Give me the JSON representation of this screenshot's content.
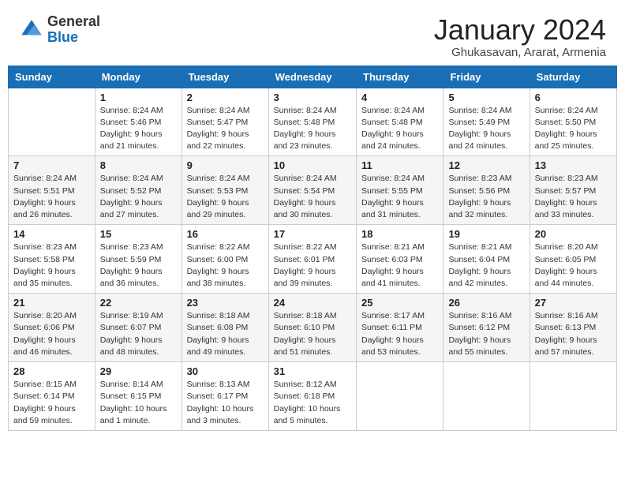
{
  "header": {
    "logo_general": "General",
    "logo_blue": "Blue",
    "month_title": "January 2024",
    "location": "Ghukasavan, Ararat, Armenia"
  },
  "weekdays": [
    "Sunday",
    "Monday",
    "Tuesday",
    "Wednesday",
    "Thursday",
    "Friday",
    "Saturday"
  ],
  "weeks": [
    [
      {
        "day": "",
        "sunrise": "",
        "sunset": "",
        "daylight": ""
      },
      {
        "day": "1",
        "sunrise": "Sunrise: 8:24 AM",
        "sunset": "Sunset: 5:46 PM",
        "daylight": "Daylight: 9 hours and 21 minutes."
      },
      {
        "day": "2",
        "sunrise": "Sunrise: 8:24 AM",
        "sunset": "Sunset: 5:47 PM",
        "daylight": "Daylight: 9 hours and 22 minutes."
      },
      {
        "day": "3",
        "sunrise": "Sunrise: 8:24 AM",
        "sunset": "Sunset: 5:48 PM",
        "daylight": "Daylight: 9 hours and 23 minutes."
      },
      {
        "day": "4",
        "sunrise": "Sunrise: 8:24 AM",
        "sunset": "Sunset: 5:48 PM",
        "daylight": "Daylight: 9 hours and 24 minutes."
      },
      {
        "day": "5",
        "sunrise": "Sunrise: 8:24 AM",
        "sunset": "Sunset: 5:49 PM",
        "daylight": "Daylight: 9 hours and 24 minutes."
      },
      {
        "day": "6",
        "sunrise": "Sunrise: 8:24 AM",
        "sunset": "Sunset: 5:50 PM",
        "daylight": "Daylight: 9 hours and 25 minutes."
      }
    ],
    [
      {
        "day": "7",
        "sunrise": "Sunrise: 8:24 AM",
        "sunset": "Sunset: 5:51 PM",
        "daylight": "Daylight: 9 hours and 26 minutes."
      },
      {
        "day": "8",
        "sunrise": "Sunrise: 8:24 AM",
        "sunset": "Sunset: 5:52 PM",
        "daylight": "Daylight: 9 hours and 27 minutes."
      },
      {
        "day": "9",
        "sunrise": "Sunrise: 8:24 AM",
        "sunset": "Sunset: 5:53 PM",
        "daylight": "Daylight: 9 hours and 29 minutes."
      },
      {
        "day": "10",
        "sunrise": "Sunrise: 8:24 AM",
        "sunset": "Sunset: 5:54 PM",
        "daylight": "Daylight: 9 hours and 30 minutes."
      },
      {
        "day": "11",
        "sunrise": "Sunrise: 8:24 AM",
        "sunset": "Sunset: 5:55 PM",
        "daylight": "Daylight: 9 hours and 31 minutes."
      },
      {
        "day": "12",
        "sunrise": "Sunrise: 8:23 AM",
        "sunset": "Sunset: 5:56 PM",
        "daylight": "Daylight: 9 hours and 32 minutes."
      },
      {
        "day": "13",
        "sunrise": "Sunrise: 8:23 AM",
        "sunset": "Sunset: 5:57 PM",
        "daylight": "Daylight: 9 hours and 33 minutes."
      }
    ],
    [
      {
        "day": "14",
        "sunrise": "Sunrise: 8:23 AM",
        "sunset": "Sunset: 5:58 PM",
        "daylight": "Daylight: 9 hours and 35 minutes."
      },
      {
        "day": "15",
        "sunrise": "Sunrise: 8:23 AM",
        "sunset": "Sunset: 5:59 PM",
        "daylight": "Daylight: 9 hours and 36 minutes."
      },
      {
        "day": "16",
        "sunrise": "Sunrise: 8:22 AM",
        "sunset": "Sunset: 6:00 PM",
        "daylight": "Daylight: 9 hours and 38 minutes."
      },
      {
        "day": "17",
        "sunrise": "Sunrise: 8:22 AM",
        "sunset": "Sunset: 6:01 PM",
        "daylight": "Daylight: 9 hours and 39 minutes."
      },
      {
        "day": "18",
        "sunrise": "Sunrise: 8:21 AM",
        "sunset": "Sunset: 6:03 PM",
        "daylight": "Daylight: 9 hours and 41 minutes."
      },
      {
        "day": "19",
        "sunrise": "Sunrise: 8:21 AM",
        "sunset": "Sunset: 6:04 PM",
        "daylight": "Daylight: 9 hours and 42 minutes."
      },
      {
        "day": "20",
        "sunrise": "Sunrise: 8:20 AM",
        "sunset": "Sunset: 6:05 PM",
        "daylight": "Daylight: 9 hours and 44 minutes."
      }
    ],
    [
      {
        "day": "21",
        "sunrise": "Sunrise: 8:20 AM",
        "sunset": "Sunset: 6:06 PM",
        "daylight": "Daylight: 9 hours and 46 minutes."
      },
      {
        "day": "22",
        "sunrise": "Sunrise: 8:19 AM",
        "sunset": "Sunset: 6:07 PM",
        "daylight": "Daylight: 9 hours and 48 minutes."
      },
      {
        "day": "23",
        "sunrise": "Sunrise: 8:18 AM",
        "sunset": "Sunset: 6:08 PM",
        "daylight": "Daylight: 9 hours and 49 minutes."
      },
      {
        "day": "24",
        "sunrise": "Sunrise: 8:18 AM",
        "sunset": "Sunset: 6:10 PM",
        "daylight": "Daylight: 9 hours and 51 minutes."
      },
      {
        "day": "25",
        "sunrise": "Sunrise: 8:17 AM",
        "sunset": "Sunset: 6:11 PM",
        "daylight": "Daylight: 9 hours and 53 minutes."
      },
      {
        "day": "26",
        "sunrise": "Sunrise: 8:16 AM",
        "sunset": "Sunset: 6:12 PM",
        "daylight": "Daylight: 9 hours and 55 minutes."
      },
      {
        "day": "27",
        "sunrise": "Sunrise: 8:16 AM",
        "sunset": "Sunset: 6:13 PM",
        "daylight": "Daylight: 9 hours and 57 minutes."
      }
    ],
    [
      {
        "day": "28",
        "sunrise": "Sunrise: 8:15 AM",
        "sunset": "Sunset: 6:14 PM",
        "daylight": "Daylight: 9 hours and 59 minutes."
      },
      {
        "day": "29",
        "sunrise": "Sunrise: 8:14 AM",
        "sunset": "Sunset: 6:15 PM",
        "daylight": "Daylight: 10 hours and 1 minute."
      },
      {
        "day": "30",
        "sunrise": "Sunrise: 8:13 AM",
        "sunset": "Sunset: 6:17 PM",
        "daylight": "Daylight: 10 hours and 3 minutes."
      },
      {
        "day": "31",
        "sunrise": "Sunrise: 8:12 AM",
        "sunset": "Sunset: 6:18 PM",
        "daylight": "Daylight: 10 hours and 5 minutes."
      },
      {
        "day": "",
        "sunrise": "",
        "sunset": "",
        "daylight": ""
      },
      {
        "day": "",
        "sunrise": "",
        "sunset": "",
        "daylight": ""
      },
      {
        "day": "",
        "sunrise": "",
        "sunset": "",
        "daylight": ""
      }
    ]
  ]
}
